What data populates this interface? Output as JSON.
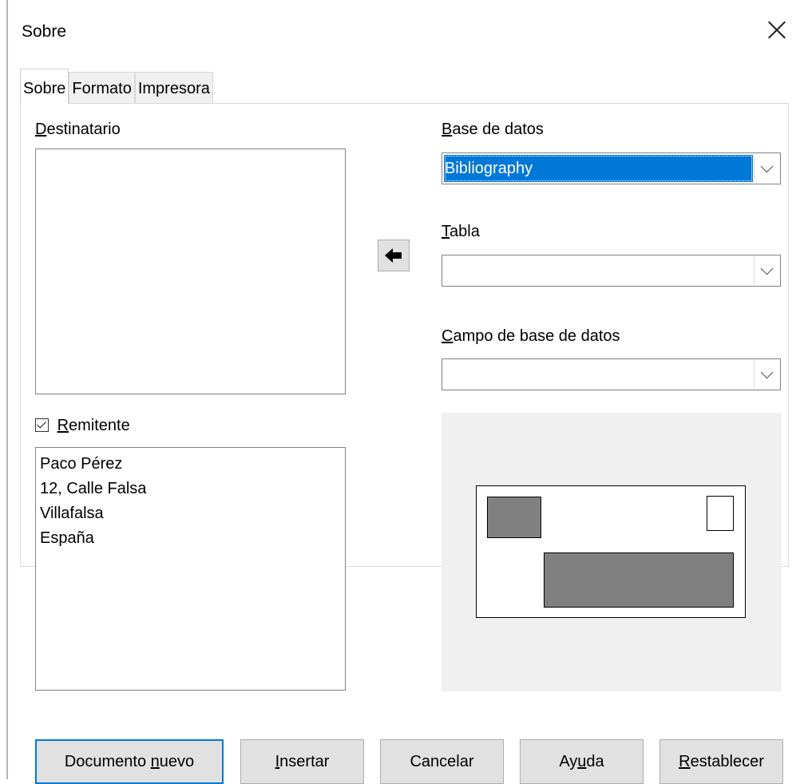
{
  "dialog": {
    "title": "Sobre"
  },
  "tabs": [
    {
      "label": "Sobre",
      "active": true
    },
    {
      "label": "Formato",
      "active": false
    },
    {
      "label": "Impresora",
      "active": false
    }
  ],
  "recipient": {
    "label_mnemonic": "D",
    "label_rest": "estinatario",
    "value": ""
  },
  "sender": {
    "checked": true,
    "label_mnemonic": "R",
    "label_rest": "emitente",
    "lines": [
      "Paco Pérez",
      "12, Calle Falsa",
      "Villafalsa",
      "España"
    ]
  },
  "database": {
    "label_mnemonic": "B",
    "label_rest": "ase de datos",
    "value": "Bibliography"
  },
  "table": {
    "label_mnemonic": "T",
    "label_rest": "abla",
    "value": ""
  },
  "db_field": {
    "label_mnemonic": "C",
    "label_rest": "ampo de base de datos",
    "value": ""
  },
  "buttons": {
    "new_doc_pre": "Documento ",
    "new_doc_mn": "n",
    "new_doc_post": "uevo",
    "insert_mn": "I",
    "insert_post": "nsertar",
    "cancel": "Cancelar",
    "help_pre": "Ay",
    "help_mn": "u",
    "help_post": "da",
    "reset_mn": "R",
    "reset_post": "establecer"
  },
  "colors": {
    "selection": "#0078d7",
    "preview_block": "#808080",
    "preview_bg": "#f0f0f0"
  },
  "icons": {
    "close": "close-icon",
    "insert_field": "arrow-left-icon"
  }
}
